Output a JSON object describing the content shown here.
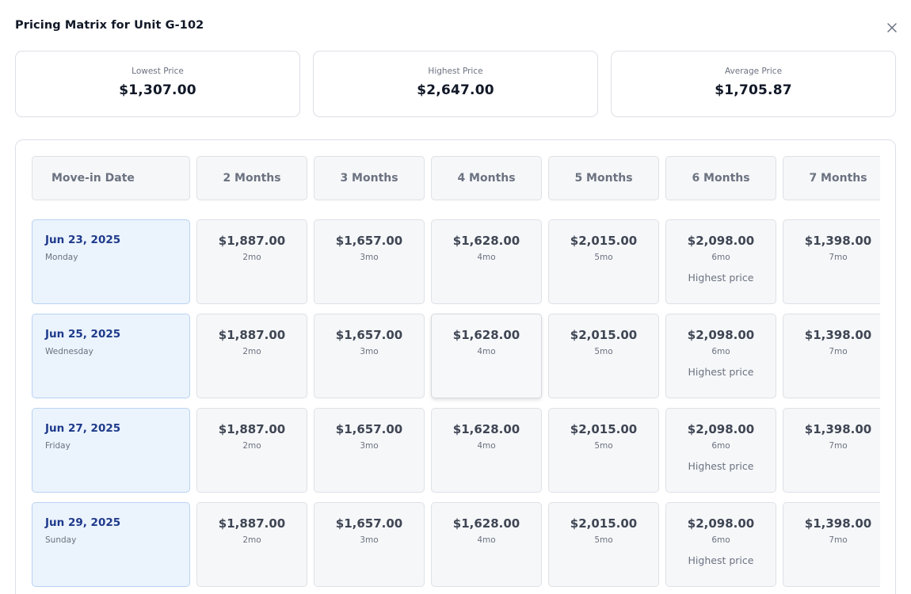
{
  "modal": {
    "title": "Pricing Matrix for Unit G-102",
    "close_icon": "close-icon"
  },
  "stats": [
    {
      "label": "Lowest Price",
      "value": "$1,307.00"
    },
    {
      "label": "Highest Price",
      "value": "$2,647.00"
    },
    {
      "label": "Average Price",
      "value": "$1,705.87"
    }
  ],
  "matrix": {
    "headers": [
      "Move-in Date",
      "2 Months",
      "3 Months",
      "4 Months",
      "5 Months",
      "6 Months",
      "7 Months"
    ],
    "rows": [
      {
        "date": "Jun 23, 2025",
        "weekday": "Monday",
        "cells": [
          {
            "price": "$1,887.00",
            "term": "2mo",
            "note": ""
          },
          {
            "price": "$1,657.00",
            "term": "3mo",
            "note": ""
          },
          {
            "price": "$1,628.00",
            "term": "4mo",
            "note": ""
          },
          {
            "price": "$2,015.00",
            "term": "5mo",
            "note": ""
          },
          {
            "price": "$2,098.00",
            "term": "6mo",
            "note": "Highest price"
          },
          {
            "price": "$1,398.00",
            "term": "7mo",
            "note": ""
          }
        ]
      },
      {
        "date": "Jun 25, 2025",
        "weekday": "Wednesday",
        "cells": [
          {
            "price": "$1,887.00",
            "term": "2mo",
            "note": ""
          },
          {
            "price": "$1,657.00",
            "term": "3mo",
            "note": ""
          },
          {
            "price": "$1,628.00",
            "term": "4mo",
            "note": ""
          },
          {
            "price": "$2,015.00",
            "term": "5mo",
            "note": ""
          },
          {
            "price": "$2,098.00",
            "term": "6mo",
            "note": "Highest price"
          },
          {
            "price": "$1,398.00",
            "term": "7mo",
            "note": ""
          }
        ]
      },
      {
        "date": "Jun 27, 2025",
        "weekday": "Friday",
        "cells": [
          {
            "price": "$1,887.00",
            "term": "2mo",
            "note": ""
          },
          {
            "price": "$1,657.00",
            "term": "3mo",
            "note": ""
          },
          {
            "price": "$1,628.00",
            "term": "4mo",
            "note": ""
          },
          {
            "price": "$2,015.00",
            "term": "5mo",
            "note": ""
          },
          {
            "price": "$2,098.00",
            "term": "6mo",
            "note": "Highest price"
          },
          {
            "price": "$1,398.00",
            "term": "7mo",
            "note": ""
          }
        ]
      },
      {
        "date": "Jun 29, 2025",
        "weekday": "Sunday",
        "cells": [
          {
            "price": "$1,887.00",
            "term": "2mo",
            "note": ""
          },
          {
            "price": "$1,657.00",
            "term": "3mo",
            "note": ""
          },
          {
            "price": "$1,628.00",
            "term": "4mo",
            "note": ""
          },
          {
            "price": "$2,015.00",
            "term": "5mo",
            "note": ""
          },
          {
            "price": "$2,098.00",
            "term": "6mo",
            "note": "Highest price"
          },
          {
            "price": "$1,398.00",
            "term": "7mo",
            "note": ""
          }
        ]
      }
    ]
  }
}
